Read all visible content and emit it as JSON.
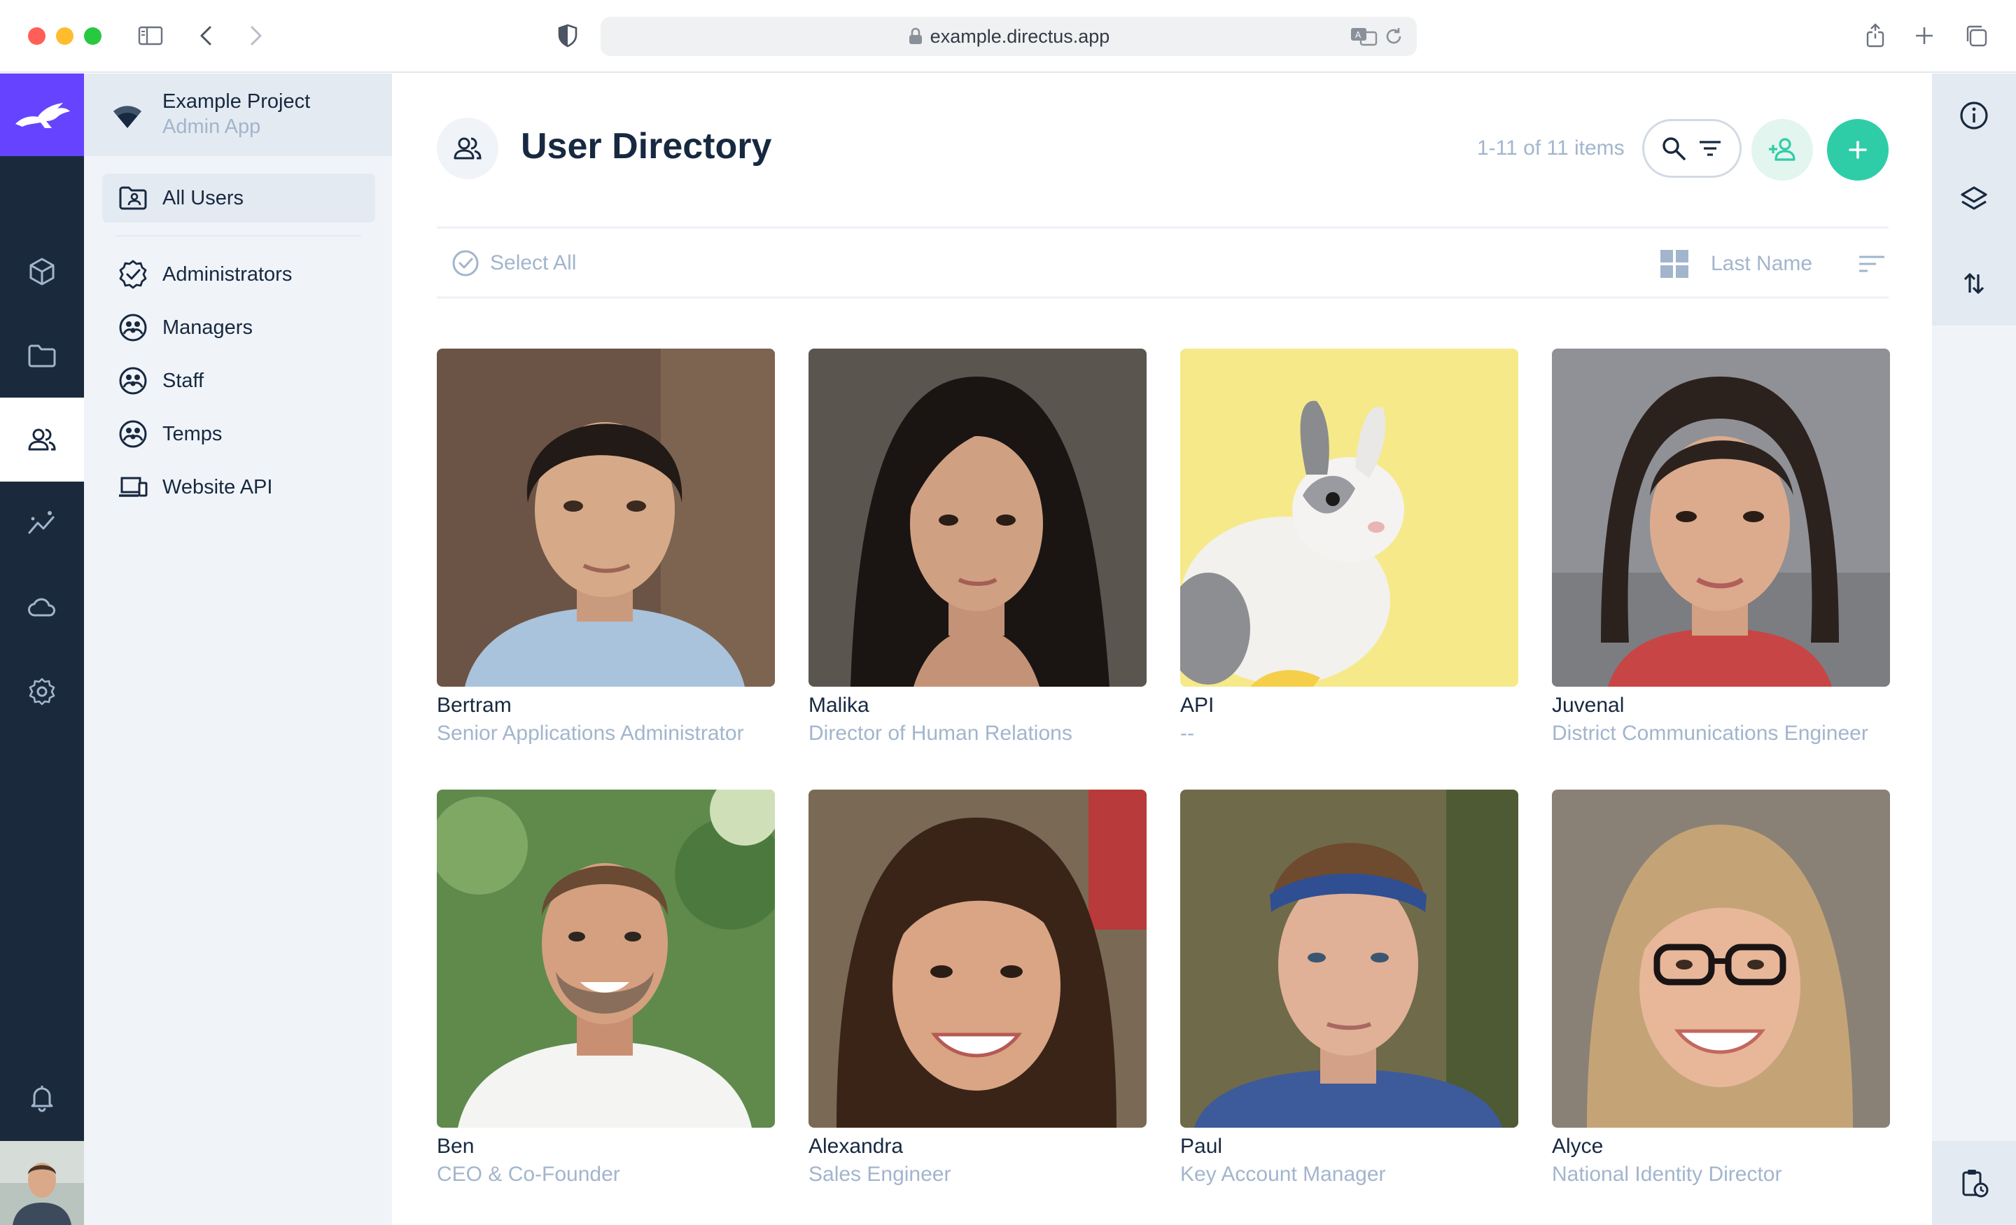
{
  "browser": {
    "url": "example.directus.app"
  },
  "project": {
    "name": "Example Project",
    "subtitle": "Admin App"
  },
  "nav": {
    "items": [
      {
        "label": "All Users",
        "icon": "folder-account-icon"
      },
      {
        "label": "Administrators",
        "icon": "verified-badge-icon"
      },
      {
        "label": "Managers",
        "icon": "role-group-icon"
      },
      {
        "label": "Staff",
        "icon": "role-group-icon"
      },
      {
        "label": "Temps",
        "icon": "role-group-icon"
      },
      {
        "label": "Website API",
        "icon": "devices-icon"
      }
    ]
  },
  "header": {
    "title": "User Directory",
    "count": "1-11 of 11 items"
  },
  "toolbar": {
    "select_all": "Select All",
    "sort_field": "Last Name"
  },
  "users": [
    {
      "name": "Bertram",
      "role": "Senior Applications Administrator"
    },
    {
      "name": "Malika",
      "role": "Director of Human Relations"
    },
    {
      "name": "API",
      "role": "--"
    },
    {
      "name": "Juvenal",
      "role": "District Communications Engineer"
    },
    {
      "name": "Ben",
      "role": "CEO & Co-Founder"
    },
    {
      "name": "Alexandra",
      "role": "Sales Engineer"
    },
    {
      "name": "Paul",
      "role": "Key Account Manager"
    },
    {
      "name": "Alyce",
      "role": "National Identity Director"
    }
  ],
  "colors": {
    "brand": "#6644ff",
    "primary": "#2ecda7",
    "module_bar": "#1a2a3c",
    "nav_bg": "#f0f4f9",
    "text": "#172940",
    "muted": "#a2b5cd"
  }
}
